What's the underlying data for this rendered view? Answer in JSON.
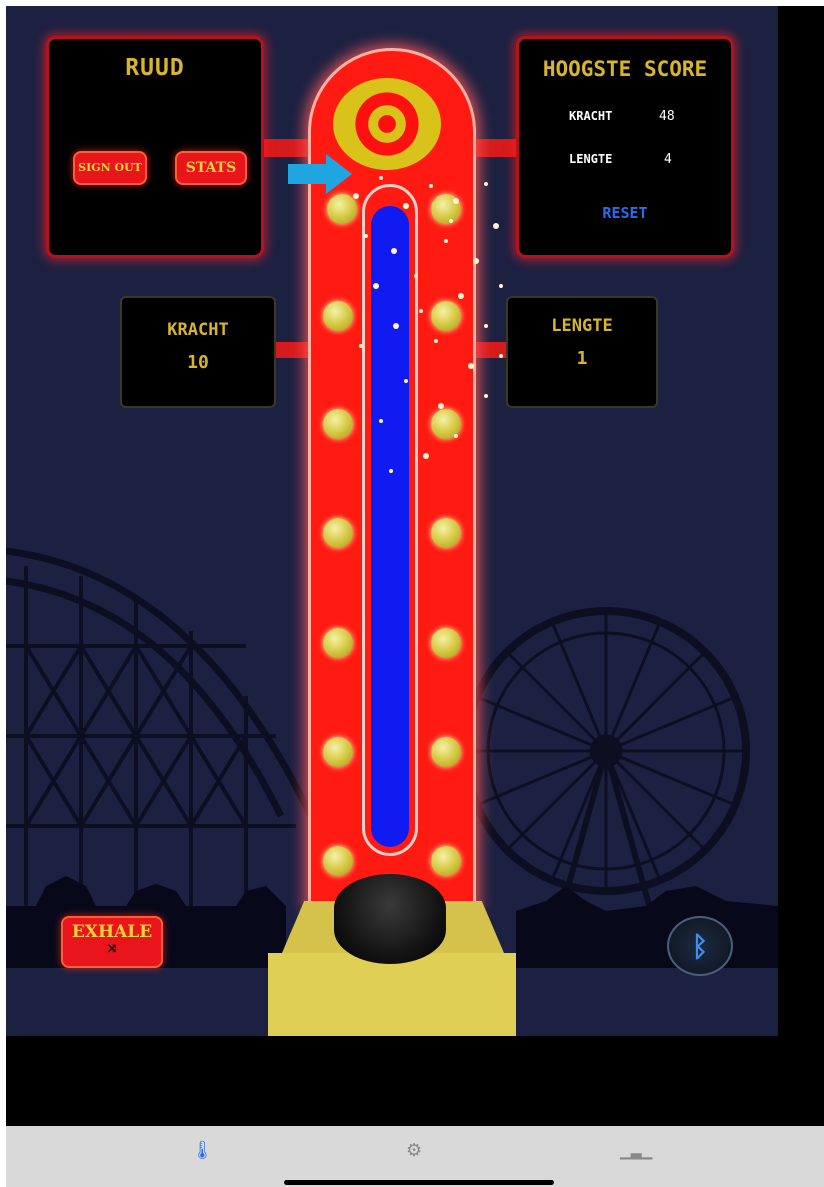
{
  "user_panel": {
    "username": "RUUD",
    "sign_out_label": "SIGN OUT",
    "stats_label": "STATS"
  },
  "highscore_panel": {
    "title": "HOOGSTE SCORE",
    "kracht_label": "KRACHT",
    "kracht_value": "48",
    "lengte_label": "LENGTE",
    "lengte_value": "4",
    "reset_label": "RESET"
  },
  "current_kracht": {
    "label": "KRACHT",
    "value": "10"
  },
  "current_lengte": {
    "label": "LENGTE",
    "value": "1"
  },
  "exhale_button": {
    "label": "EXHALE",
    "icon": "shuffle-icon"
  },
  "bluetooth_button": {
    "icon": "bluetooth-icon"
  },
  "meter": {
    "fill_fraction": 0.98
  },
  "tabs": [
    {
      "icon": "thermometer-icon",
      "active": true
    },
    {
      "icon": "gear-icon",
      "active": false
    },
    {
      "icon": "podium-icon",
      "active": false
    }
  ],
  "colors": {
    "background": "#1c2142",
    "accent_red": "#e8151c",
    "gold": "#d9b52a",
    "meter_blue": "#0f1bf0",
    "link_blue": "#2a6cf0"
  }
}
